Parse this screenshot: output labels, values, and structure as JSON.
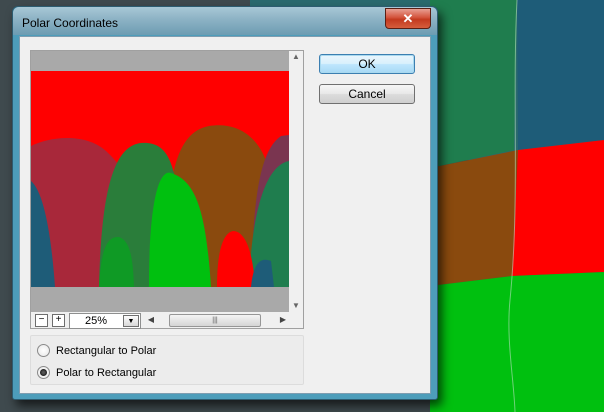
{
  "dialog": {
    "title": "Polar Coordinates",
    "close_glyph": "✕"
  },
  "buttons": {
    "ok_label": "OK",
    "cancel_label": "Cancel"
  },
  "zoom": {
    "minus_glyph": "−",
    "plus_glyph": "+",
    "value": "25%"
  },
  "options": {
    "rect_to_polar": "Rectangular to Polar",
    "polar_to_rect": "Polar to Rectangular",
    "selected": "polar_to_rect"
  },
  "icons": {
    "close": "close-icon",
    "zoom_out": "minus-icon",
    "zoom_in": "plus-icon",
    "dropdown": "chevron-down-icon",
    "scroll_left": "triangle-left-icon",
    "scroll_right": "triangle-right-icon",
    "scroll_up": "triangle-up-icon",
    "scroll_down": "triangle-down-icon"
  },
  "colors": {
    "red": "#ff0000",
    "green": "#00c00f",
    "teal": "#1f7d4e",
    "blue": "#1e5c78",
    "brown": "#8a4a0e"
  }
}
